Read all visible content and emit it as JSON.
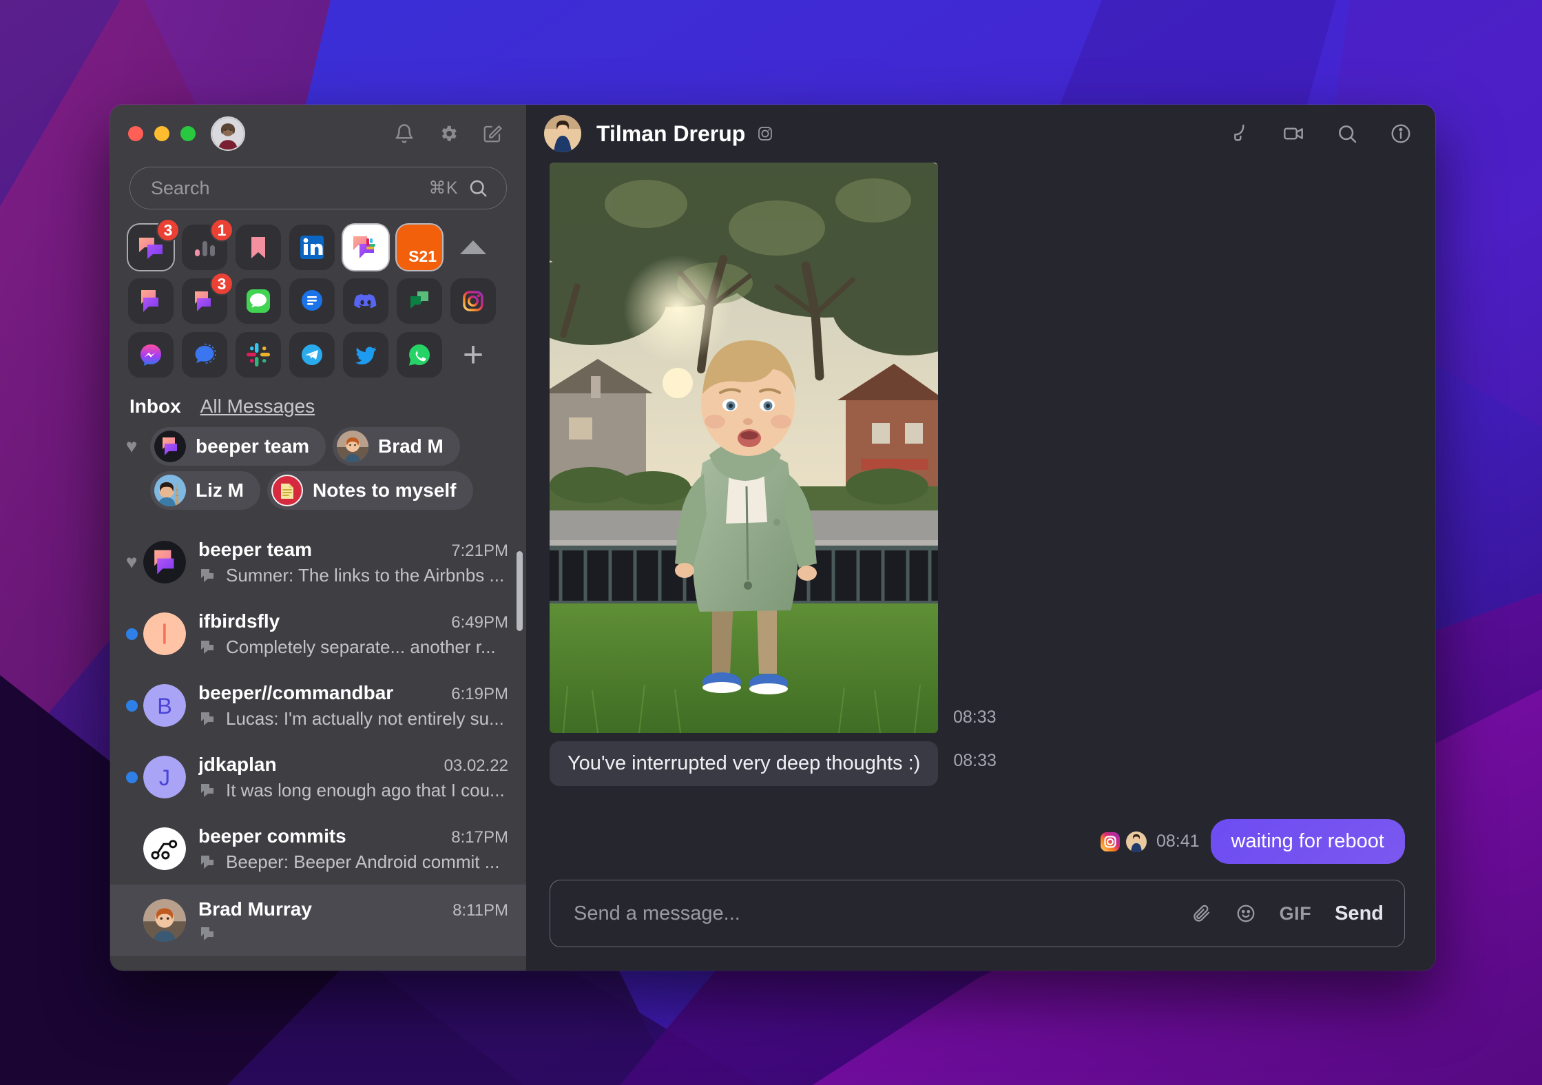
{
  "window": {
    "traffic_lights": [
      "close",
      "minimize",
      "maximize"
    ],
    "titlebar_icons": [
      "bell-icon",
      "gear-icon",
      "compose-icon"
    ]
  },
  "search": {
    "placeholder": "Search",
    "value": "",
    "shortcut": "⌘K",
    "icon": "search-icon"
  },
  "app_grid": {
    "rows": [
      [
        {
          "name": "beeper-chat-app",
          "badge": "3",
          "selected": true,
          "style": "dark"
        },
        {
          "name": "beeper-analytics-app",
          "badge": "1",
          "selected": false,
          "style": "dark"
        },
        {
          "name": "bookmark-app",
          "badge": "",
          "selected": false,
          "style": "dark"
        },
        {
          "name": "linkedin-app",
          "badge": "",
          "selected": false,
          "style": "dark"
        },
        {
          "name": "beeper-slack-app",
          "badge": "",
          "selected": false,
          "style": "white"
        },
        {
          "name": "s21-app",
          "badge": "",
          "selected": false,
          "style": "orange",
          "label": "S21"
        },
        {
          "name": "collapse-grid-toggle",
          "badge": "",
          "selected": false,
          "style": "tail-triangle"
        }
      ],
      [
        {
          "name": "beeper-app",
          "badge": "",
          "selected": false,
          "style": "dark"
        },
        {
          "name": "beeper-alt-app",
          "badge": "3",
          "selected": false,
          "style": "dark"
        },
        {
          "name": "imessage-app",
          "badge": "",
          "selected": false,
          "style": "dark"
        },
        {
          "name": "sms-app",
          "badge": "",
          "selected": false,
          "style": "dark"
        },
        {
          "name": "discord-app",
          "badge": "",
          "selected": false,
          "style": "dark"
        },
        {
          "name": "google-chat-app",
          "badge": "",
          "selected": false,
          "style": "dark"
        },
        {
          "name": "instagram-app",
          "badge": "",
          "selected": false,
          "style": "dark"
        }
      ],
      [
        {
          "name": "messenger-app",
          "badge": "",
          "selected": false,
          "style": "dark"
        },
        {
          "name": "signal-app",
          "badge": "",
          "selected": false,
          "style": "dark"
        },
        {
          "name": "slack-app",
          "badge": "",
          "selected": false,
          "style": "dark"
        },
        {
          "name": "telegram-app",
          "badge": "",
          "selected": false,
          "style": "dark"
        },
        {
          "name": "twitter-app",
          "badge": "",
          "selected": false,
          "style": "dark"
        },
        {
          "name": "whatsapp-app",
          "badge": "",
          "selected": false,
          "style": "dark"
        },
        {
          "name": "add-account-button",
          "badge": "",
          "selected": false,
          "style": "tail-plus"
        }
      ]
    ]
  },
  "tabs": {
    "inbox_label": "Inbox",
    "all_messages_label": "All Messages",
    "active": "Inbox"
  },
  "pinned": {
    "rows": [
      {
        "heart": "♥",
        "chips": [
          {
            "name": "beeper team",
            "avatar": "beeper-logo",
            "active": true
          },
          {
            "name": "Brad M",
            "avatar": "brad-photo",
            "active": true
          }
        ]
      },
      {
        "heart": "",
        "chips": [
          {
            "name": "Liz M",
            "avatar": "liz-photo",
            "active": true
          },
          {
            "name": "Notes to myself",
            "avatar": "notes-icon",
            "active": true
          }
        ]
      }
    ]
  },
  "chats": [
    {
      "title": "beeper team",
      "time": "7:21PM",
      "preview": "Sumner: The links to the Airbnbs ...",
      "mark": "heart",
      "avatar": "beeper-logo",
      "network": "beeper-network-icon",
      "hovered": false
    },
    {
      "title": "ifbirdsfly",
      "time": "6:49PM",
      "preview": "Completely separate... another r...",
      "mark": "unread",
      "avatar": "letter-I-peach",
      "network": "beeper-network-icon",
      "hovered": false
    },
    {
      "title": "beeper//commandbar",
      "time": "6:19PM",
      "preview": "Lucas: I'm actually not entirely su...",
      "mark": "unread",
      "avatar": "letter-B-purple",
      "network": "beeper-network-icon",
      "hovered": false
    },
    {
      "title": "jdkaplan",
      "time": "03.02.22",
      "preview": "It was long enough ago that I cou...",
      "mark": "unread",
      "avatar": "letter-J-purple",
      "network": "beeper-network-icon",
      "hovered": false
    },
    {
      "title": "beeper commits",
      "time": "8:17PM",
      "preview": "Beeper: Beeper Android commit ...",
      "mark": "none",
      "avatar": "git-graph-white",
      "network": "beeper-network-icon",
      "hovered": false
    },
    {
      "title": "Brad Murray",
      "time": "8:11PM",
      "preview": "",
      "mark": "none",
      "avatar": "brad-photo",
      "network": "beeper-network-icon",
      "hovered": true
    }
  ],
  "conversation": {
    "peer_name": "Tilman Drerup",
    "peer_network_icon": "instagram-icon",
    "peer_avatar": "tilman-photo",
    "actions": [
      "phone-icon",
      "video-camera-icon",
      "search-icon",
      "info-icon"
    ],
    "messages": [
      {
        "kind": "image",
        "direction": "incoming",
        "time": "08:33",
        "alt": "toddler-in-green-jacket-photo"
      },
      {
        "kind": "text",
        "direction": "incoming",
        "time": "08:33",
        "text": "You've interrupted very deep thoughts :)"
      },
      {
        "kind": "text",
        "direction": "outgoing",
        "time": "08:41",
        "text": "waiting for reboot",
        "network_icon": "instagram-icon",
        "sender_avatar": "tilman-photo"
      }
    ]
  },
  "composer": {
    "placeholder": "Send a message...",
    "value": "",
    "attach_icon": "paperclip-icon",
    "emoji_icon": "smiley-icon",
    "gif_label": "GIF",
    "send_label": "Send"
  },
  "colors": {
    "sidebar_bg": "#3e3e43",
    "conversation_bg": "#26262f",
    "accent_purple": "#6d4cf2",
    "badge_red": "#eb4034",
    "unread_blue": "#2f7fe8",
    "incoming_bubble": "#3a3a44"
  }
}
